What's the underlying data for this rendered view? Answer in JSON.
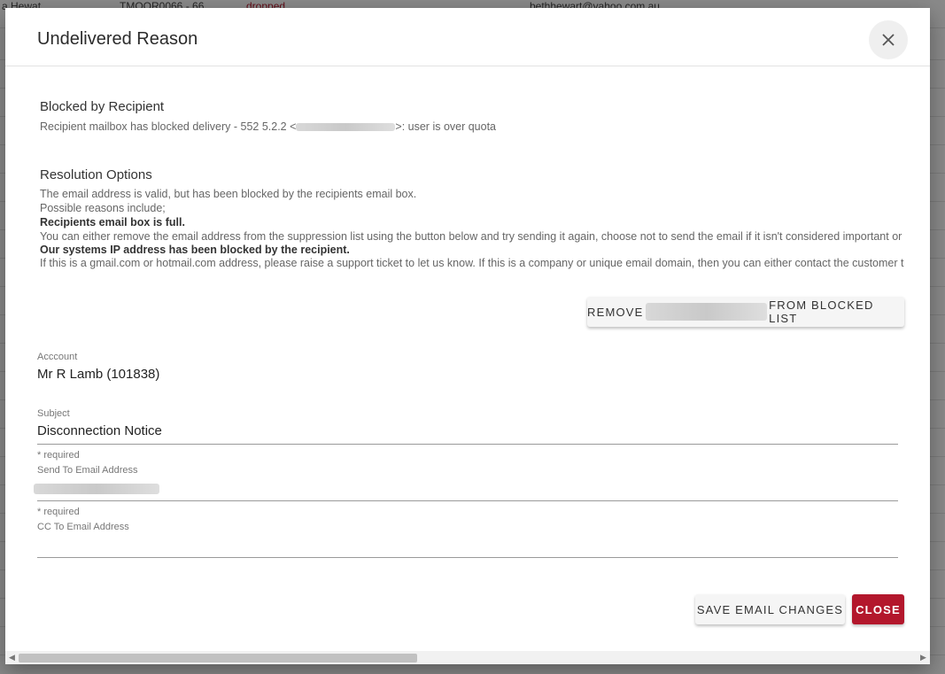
{
  "background": {
    "top_row": {
      "name": "a Hewat",
      "ref": "TMOOR0066 - 66",
      "status": "dropped",
      "email": "bethhewart@yahoo.com.au"
    }
  },
  "dialog": {
    "title": "Undelivered Reason",
    "blocked": {
      "heading": "Blocked by Recipient",
      "message_prefix": "Recipient mailbox has blocked delivery - 552 5.2.2 <",
      "message_suffix": ">: user is over quota"
    },
    "resolution": {
      "heading": "Resolution Options",
      "line1": "The email address is valid, but has been blocked by the recipients email box.",
      "line2": "Possible reasons include;",
      "line3": "Recipients email box is full.",
      "line4": "You can either remove the email address from the suppression list using the button below and try sending it again, choose not to send the email if it isn't considered important or",
      "line5": "Our systems IP address has been blocked by the recipient.",
      "line6": "If this is a gmail.com or hotmail.com address, please raise a support ticket to let us know.  If this is a company or unique email domain, then you can either contact the customer t"
    },
    "remove_button": {
      "prefix": "REMOVE",
      "suffix": "FROM BLOCKED LIST"
    },
    "account": {
      "label": "Acccount",
      "value": "Mr R Lamb (101838)"
    },
    "subject": {
      "label": "Subject",
      "value": "Disconnection Notice",
      "required": "* required"
    },
    "send_to": {
      "label": "Send To Email Address",
      "required": "* required"
    },
    "cc_to": {
      "label": "CC To Email Address"
    },
    "save_button": "SAVE EMAIL CHANGES",
    "close_button": "CLOSE",
    "accent": "#b3172c"
  }
}
